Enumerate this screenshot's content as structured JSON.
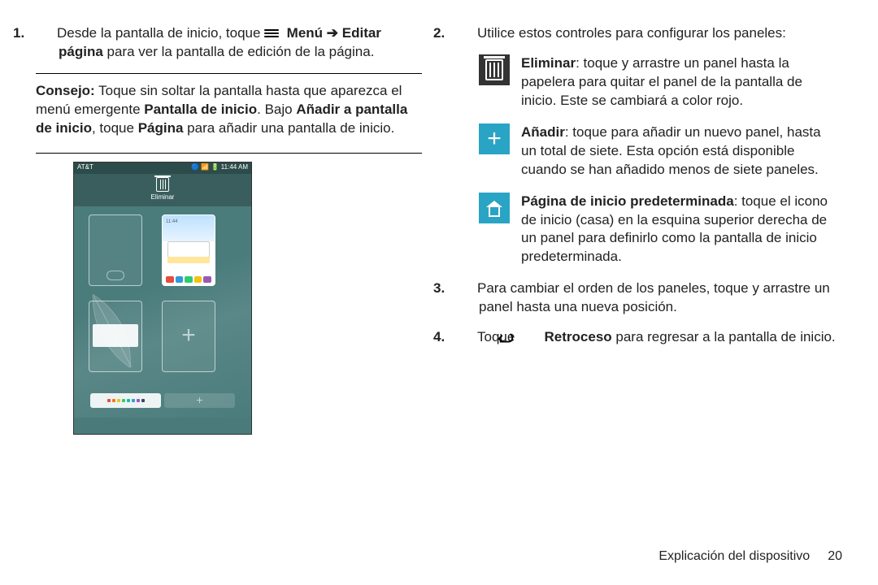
{
  "left": {
    "step1": {
      "num": "1.",
      "pre": "Desde la pantalla de inicio, toque ",
      "menu_label": "Menú",
      "arrow": " ➔ ",
      "edit_bold": "Editar página",
      "post": " para ver la pantalla de edición de la página."
    },
    "consejo": {
      "lead": "Consejo:",
      "line1": " Toque sin soltar la pantalla hasta que aparezca el menú emergente ",
      "bold1": "Pantalla de inicio",
      "mid": ". Bajo ",
      "bold2": "Añadir a pantalla de inicio",
      "mid2": ", toque ",
      "bold3": "Página",
      "end": " para añadir una pantalla de inicio."
    },
    "screenshot": {
      "carrier": "AT&T",
      "clock": "🔵 📶 🔋 11:44 AM",
      "trash_label": "Eliminar",
      "mini_time": "11:44"
    }
  },
  "right": {
    "step2": {
      "num": "2.",
      "text": "Utilice estos controles para configurar los paneles:"
    },
    "eliminar": {
      "bold": "Eliminar",
      "text": ": toque y arrastre un panel hasta la papelera para quitar el panel de la pantalla de inicio. Este se cambiará a color rojo."
    },
    "anadir": {
      "bold": "Añadir",
      "text": ": toque para añadir un nuevo panel, hasta un total de siete. Esta opción está disponible cuando se han añadido menos de siete paneles."
    },
    "home": {
      "bold": "Página de inicio predeterminada",
      "text": ": toque el icono de inicio (casa) en la esquina superior derecha de un panel para definirlo como la pantalla de inicio predeterminada."
    },
    "step3": {
      "num": "3.",
      "text": "Para cambiar el orden de los paneles, toque y arrastre un panel hasta una nueva posición."
    },
    "step4": {
      "num": "4.",
      "pre": "Toque ",
      "bold": "Retroceso",
      "post": " para regresar a la pantalla de inicio."
    }
  },
  "footer": {
    "section": "Explicación del dispositivo",
    "page": "20"
  }
}
